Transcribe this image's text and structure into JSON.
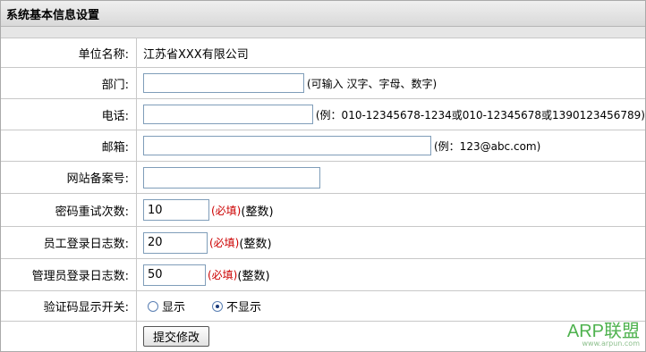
{
  "header": {
    "title": "系统基本信息设置"
  },
  "form": {
    "company": {
      "label": "单位名称:",
      "value": "江苏省XXX有限公司"
    },
    "dept": {
      "label": "部门:",
      "value": "",
      "hint": "(可输入 汉字、字母、数字)"
    },
    "phone": {
      "label": "电话:",
      "value": "",
      "hint": "(例：010-12345678-1234或010-12345678或1390123456789)"
    },
    "email": {
      "label": "邮箱:",
      "value": "",
      "hint": "(例：123@abc.com)"
    },
    "icp": {
      "label": "网站备案号:",
      "value": ""
    },
    "pwd_retry": {
      "label": "密码重试次数:",
      "value": "10",
      "required": "(必填)",
      "type_hint": "(整数)"
    },
    "emp_log": {
      "label": "员工登录日志数:",
      "value": "20",
      "required": "(必填)",
      "type_hint": "(整数)"
    },
    "admin_log": {
      "label": "管理员登录日志数:",
      "value": "50",
      "required": "(必填)",
      "type_hint": "(整数)"
    },
    "captcha": {
      "label": "验证码显示开关:",
      "options": [
        "显示",
        "不显示"
      ],
      "selected": "不显示"
    },
    "submit_label": "提交修改"
  },
  "watermark": {
    "brand": "ARP联盟",
    "url": "www.arpun.com"
  }
}
